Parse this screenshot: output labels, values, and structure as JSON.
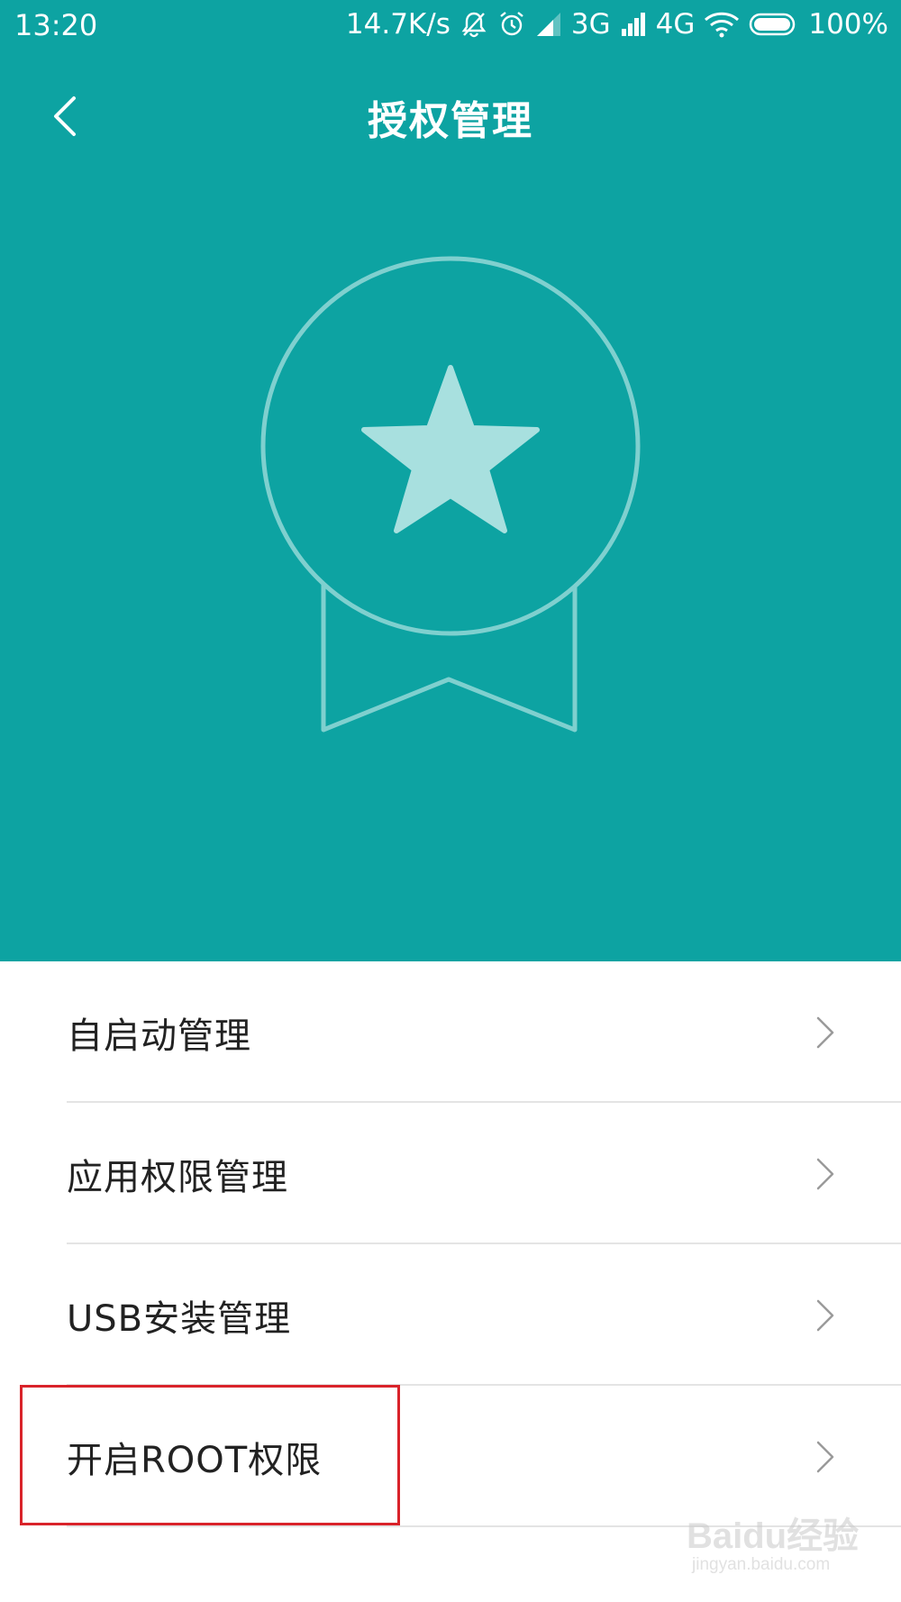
{
  "status_bar": {
    "time": "13:20",
    "net_speed": "14.7K/s",
    "sim1_type": "3G",
    "sim2_type": "4G",
    "battery": "100%"
  },
  "header": {
    "title": "授权管理",
    "background_color": "#0da3a2",
    "badge_icon": "medal-star-icon"
  },
  "menu": {
    "items": [
      {
        "label": "自启动管理"
      },
      {
        "label": "应用权限管理"
      },
      {
        "label": "USB安装管理"
      },
      {
        "label": "开启ROOT权限",
        "highlighted": true
      }
    ]
  },
  "annotation": {
    "highlight_color": "#d9232a"
  },
  "watermark": {
    "logo": "Baidu经验",
    "url": "jingyan.baidu.com"
  }
}
